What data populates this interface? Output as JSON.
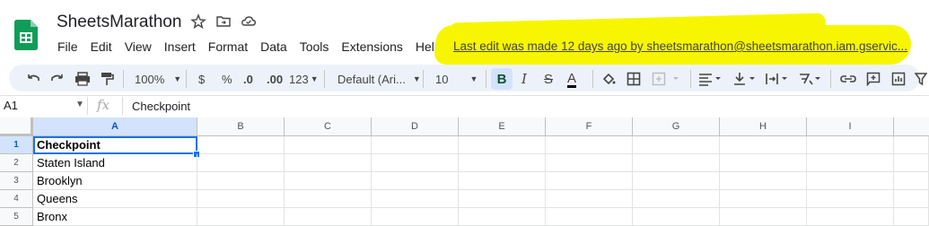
{
  "app": {
    "title": "SheetsMarathon",
    "last_edit": "Last edit was made 12 days ago by sheetsmarathon@sheetsmarathon.iam.gservic...",
    "brand_color": "#0f9d58",
    "highlight_color": "#f7f600"
  },
  "menu": [
    "File",
    "Edit",
    "View",
    "Insert",
    "Format",
    "Data",
    "Tools",
    "Extensions",
    "Help"
  ],
  "toolbar": {
    "zoom": "100%",
    "currency": "$",
    "percent": "%",
    "dec_decrease": ".0",
    "dec_increase": ".00",
    "format_more": "123",
    "font": "Default (Ari...",
    "font_size": "10",
    "bold": "B",
    "italic": "I",
    "strike": "S",
    "text_color": "A"
  },
  "formula_bar": {
    "cell_ref": "A1",
    "fx": "fx",
    "value": "Checkpoint"
  },
  "columns": [
    "A",
    "B",
    "C",
    "D",
    "E",
    "F",
    "G",
    "H",
    "I"
  ],
  "rows": [
    {
      "num": "1",
      "A": "Checkpoint",
      "bold": true
    },
    {
      "num": "2",
      "A": "Staten Island"
    },
    {
      "num": "3",
      "A": "Brooklyn"
    },
    {
      "num": "4",
      "A": "Queens"
    },
    {
      "num": "5",
      "A": "Bronx"
    }
  ]
}
